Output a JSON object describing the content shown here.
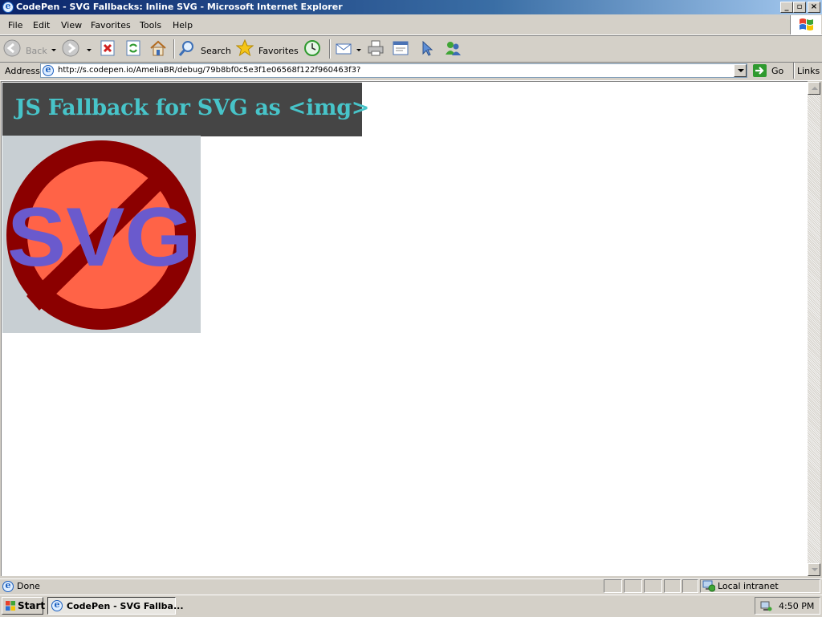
{
  "window": {
    "title": "CodePen - SVG Fallbacks: Inline SVG - Microsoft Internet Explorer",
    "caption_buttons": [
      "_",
      "▫",
      "×"
    ]
  },
  "menu": {
    "items": [
      "File",
      "Edit",
      "View",
      "Favorites",
      "Tools",
      "Help"
    ]
  },
  "toolbar": {
    "back_label": "Back",
    "search_label": "Search",
    "favorites_label": "Favorites"
  },
  "address": {
    "label": "Address",
    "url": "http://s.codepen.io/AmeliaBR/debug/79b8bf0c5e3f1e06568f122f960463f3?",
    "go_label": "Go",
    "links_label": "Links"
  },
  "page": {
    "heading": "JS Fallback for SVG as <img>",
    "image_text": "SVG",
    "colors": {
      "heading_bg": "#454545",
      "heading_text": "#47c4c9",
      "image_bg": "#c8cfd3",
      "circle": "#8b0000",
      "slash": "#ff6347",
      "svg_text": "#6a5acd"
    }
  },
  "status": {
    "text": "Done",
    "zone": "Local intranet"
  },
  "taskbar": {
    "start_label": "Start",
    "task_label": "CodePen - SVG Fallba...",
    "clock": "4:50 PM"
  }
}
